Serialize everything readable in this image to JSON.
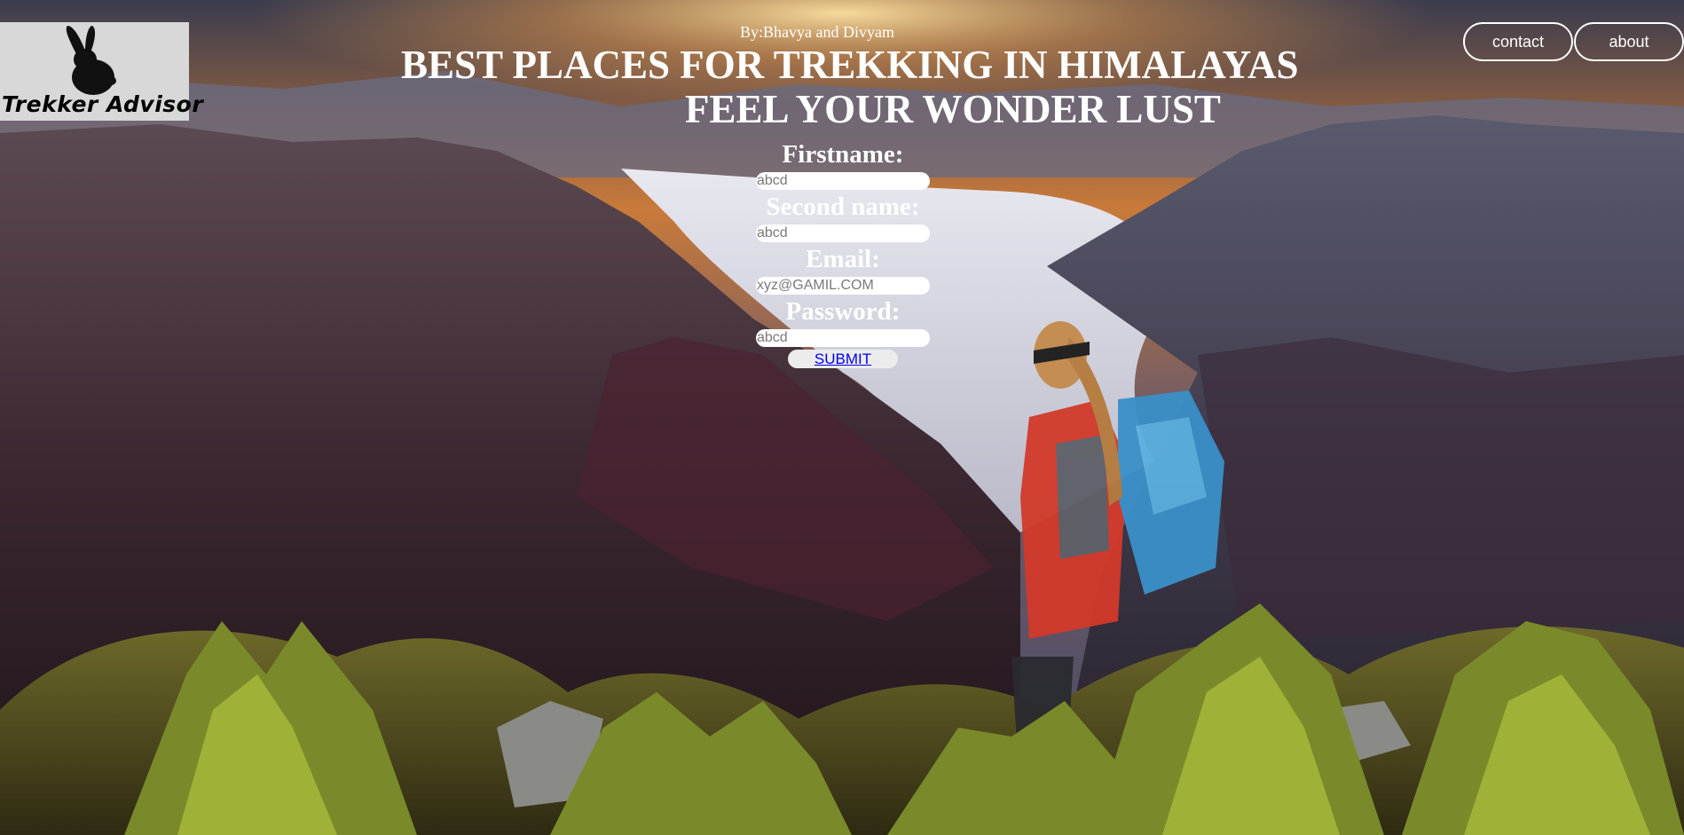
{
  "header": {
    "logo_text": "Trekker Advisor",
    "byline": "By:Bhavya and Divyam",
    "title_line1": "BEST PLACES FOR TREKKING IN HIMALAYAS",
    "title_line2": "FEEL YOUR WONDER LUST"
  },
  "nav": {
    "contact_label": "contact",
    "about_label": "about"
  },
  "form": {
    "firstname_label": "Firstname:",
    "firstname_placeholder": "abcd",
    "secondname_label": "Second name:",
    "secondname_placeholder": "abcd",
    "email_label": "Email:",
    "email_placeholder": "xyz@GAMIL.COM",
    "password_label": "Password:",
    "password_placeholder": "abcd",
    "submit_label": "SUBMIT"
  }
}
